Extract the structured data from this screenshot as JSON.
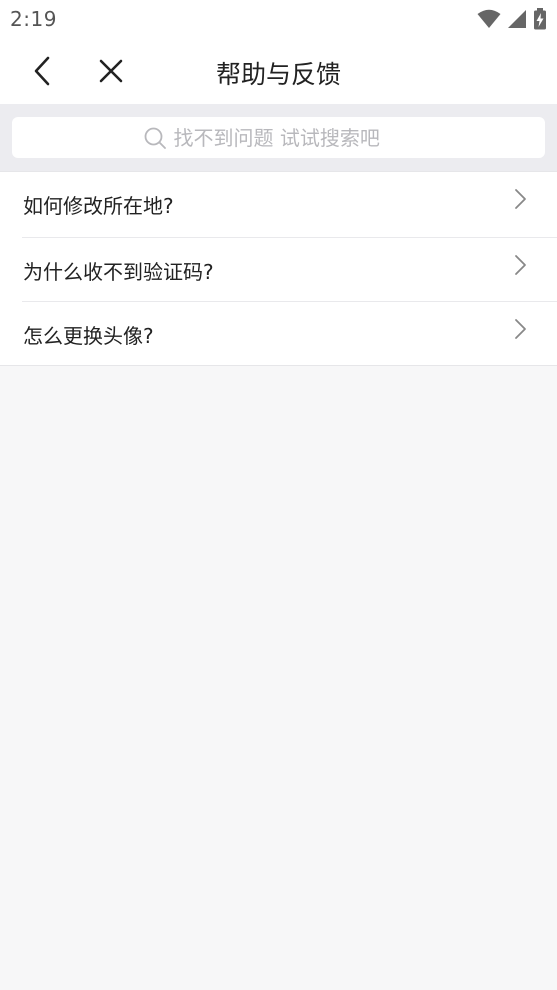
{
  "status_bar": {
    "time": "2:19"
  },
  "nav": {
    "title": "帮助与反馈"
  },
  "search": {
    "placeholder": "找不到问题 试试搜索吧"
  },
  "faq": {
    "items": [
      {
        "label": "如何修改所在地?"
      },
      {
        "label": "为什么收不到验证码?"
      },
      {
        "label": "怎么更换头像?"
      }
    ]
  },
  "colors": {
    "background": "#f7f7f8",
    "search_band": "#ececf0",
    "placeholder": "#b8b8bc",
    "text": "#222222"
  },
  "icons": {
    "back": "chevron-left-icon",
    "close": "close-icon",
    "search": "search-icon",
    "item_arrow": "chevron-right-icon",
    "wifi": "wifi-icon",
    "signal": "signal-icon",
    "battery": "battery-charging-icon"
  }
}
